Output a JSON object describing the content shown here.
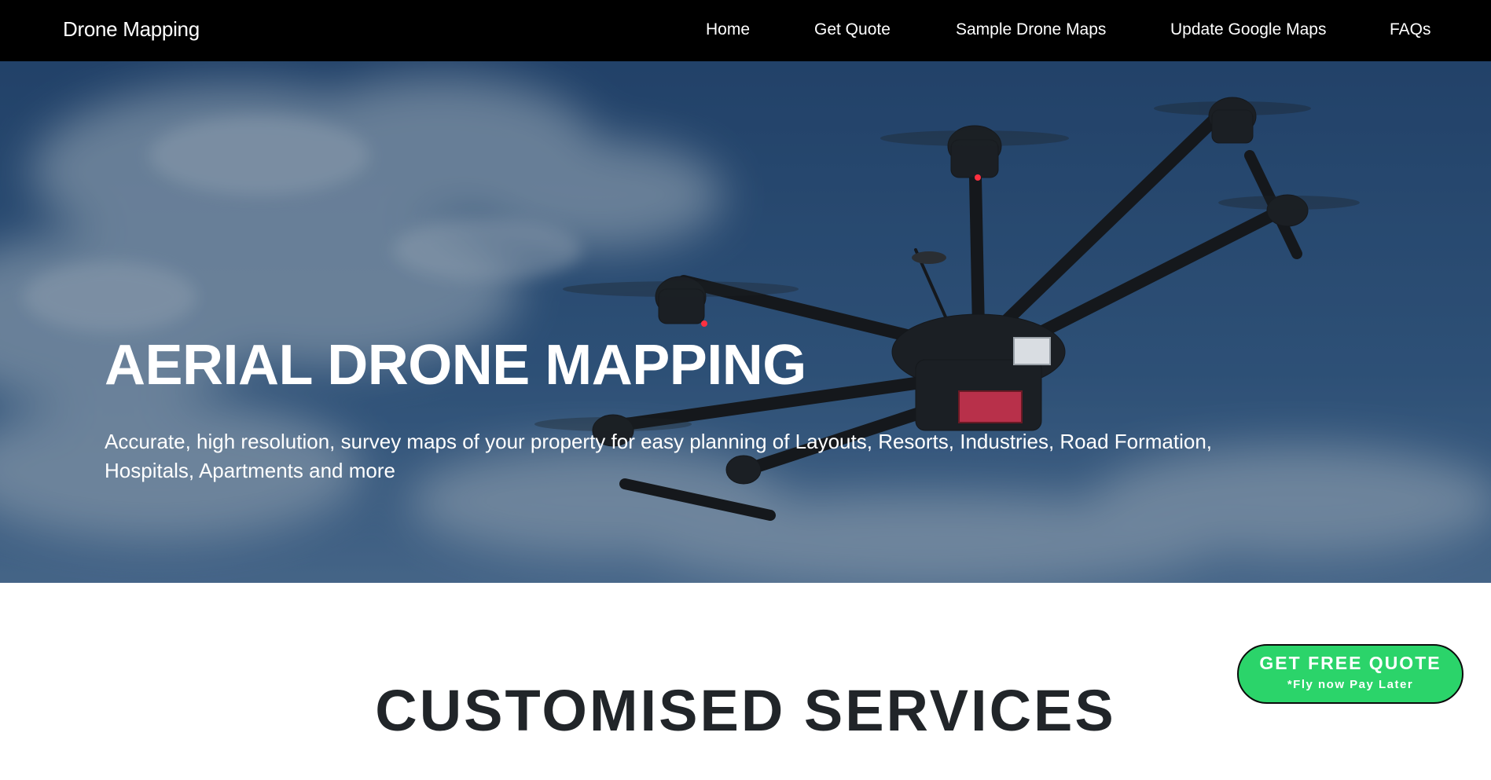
{
  "nav": {
    "brand": "Drone Mapping",
    "links": [
      "Home",
      "Get Quote",
      "Sample Drone Maps",
      "Update Google Maps",
      "FAQs"
    ]
  },
  "hero": {
    "title": "AERIAL DRONE MAPPING",
    "subtitle": "Accurate, high resolution, survey maps of your property for easy planning of Layouts, Resorts, Industries, Road Formation, Hospitals, Apartments and more",
    "image": "drone-in-sky-photo"
  },
  "section": {
    "title": "CUSTOMISED SERVICES"
  },
  "cta": {
    "label": "GET FREE QUOTE",
    "sublabel": "*Fly now Pay Later"
  },
  "colors": {
    "navbar": "#000000",
    "cta": "#2bd46a",
    "heading": "#212529",
    "sky": "#2d5683"
  }
}
